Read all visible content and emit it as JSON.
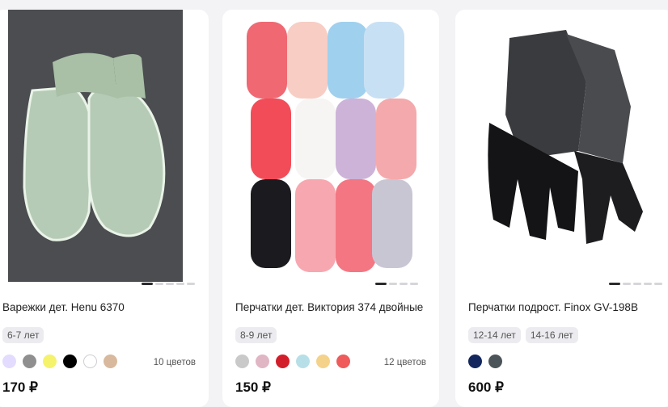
{
  "products": [
    {
      "title": "Варежки дет. Henu 6370",
      "sizes": [
        "6-7 лет"
      ],
      "colors": [
        "#e3dcff",
        "#8f8f8f",
        "#f5f36b",
        "#000000",
        "#ffffff",
        "#d8b99d"
      ],
      "colors_count": "10 цветов",
      "price": "170 ₽"
    },
    {
      "title": "Перчатки дет. Виктория 374 двойные",
      "sizes": [
        "8-9 лет"
      ],
      "colors": [
        "#c9c9c9",
        "#e0b6c4",
        "#d21e2a",
        "#b7dfe8",
        "#f5d28a",
        "#ef5a5a"
      ],
      "colors_count": "12 цветов",
      "price": "150 ₽"
    },
    {
      "title": "Перчатки подрост. Finox GV-198B",
      "sizes": [
        "12-14 лет",
        "14-16 лет"
      ],
      "colors": [
        "#13275e",
        "#4a5459"
      ],
      "colors_count": "",
      "price": "600 ₽"
    }
  ]
}
